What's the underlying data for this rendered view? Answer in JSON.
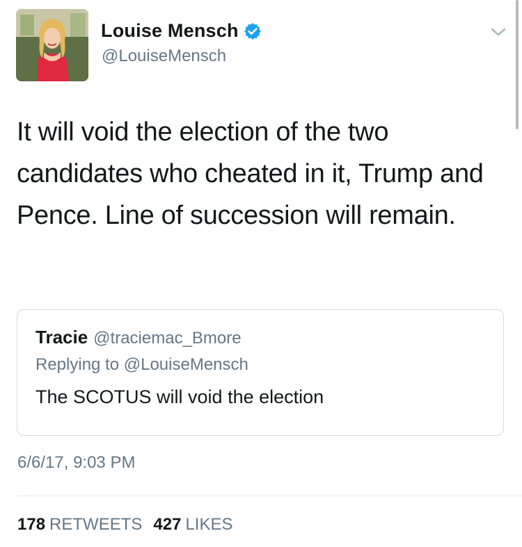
{
  "author": {
    "display_name": "Louise Mensch",
    "handle": "@LouiseMensch",
    "verified": true
  },
  "icons": {
    "verified": "verified-badge-icon",
    "menu": "chevron-down-icon"
  },
  "tweet": {
    "text": "It will void the election of the two candidates who cheated in it, Trump and Pence. Line of succession will remain."
  },
  "quoted_tweet": {
    "display_name": "Tracie",
    "handle": "@traciemac_Bmore",
    "replying_to": "Replying to @LouiseMensch",
    "text": "The SCOTUS will void the election"
  },
  "timestamp": "6/6/17, 9:03 PM",
  "stats": {
    "retweets_count": "178",
    "retweets_label": "RETWEETS",
    "likes_count": "427",
    "likes_label": "LIKES"
  },
  "colors": {
    "verified_blue": "#1da1f2",
    "text_primary": "#14171a",
    "text_secondary": "#657786",
    "border": "#d5dbe0"
  }
}
